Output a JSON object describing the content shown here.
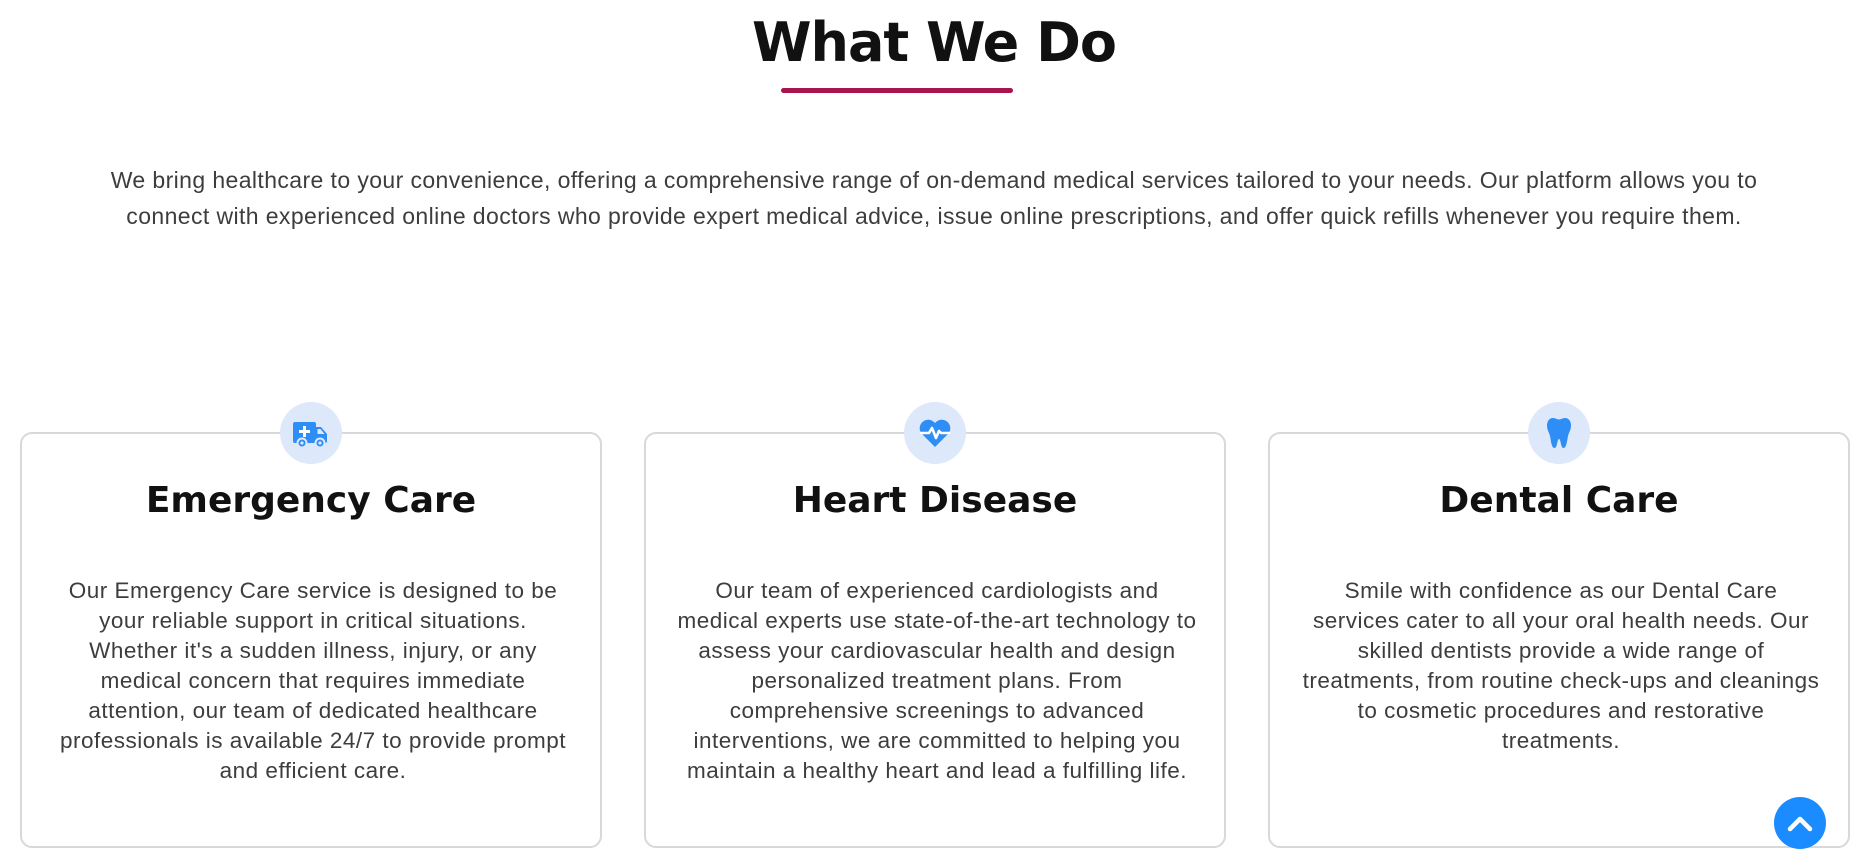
{
  "section": {
    "title": "What We Do",
    "intro": "We bring healthcare to your convenience, offering a comprehensive range of on-demand medical services tailored to your needs. Our platform allows you to connect with experienced online doctors who provide expert medical advice, issue online prescriptions, and offer quick refills whenever you require them."
  },
  "services": [
    {
      "icon": "ambulance-icon",
      "title": "Emergency Care",
      "text": "Our Emergency Care service is designed to be your reliable support in critical situations. Whether it's a sudden illness, injury, or any medical concern that requires immediate attention, our team of dedicated healthcare professionals is available 24/7 to provide prompt and efficient care."
    },
    {
      "icon": "heart-pulse-icon",
      "title": "Heart Disease",
      "text": "Our team of experienced cardiologists and medical experts use state-of-the-art technology to assess your cardiovascular health and design personalized treatment plans. From comprehensive screenings to advanced interventions, we are committed to helping you maintain a healthy heart and lead a fulfilling life."
    },
    {
      "icon": "tooth-icon",
      "title": "Dental Care",
      "text": "Smile with confidence as our Dental Care services cater to all your oral health needs. Our skilled dentists provide a wide range of treatments, from routine check-ups and cleanings to cosmetic procedures and restorative treatments."
    }
  ],
  "scroll_top": {
    "icon": "chevron-up-icon"
  },
  "colors": {
    "accent_underline": "#a8154e",
    "icon_blue": "#2f8ef5",
    "icon_bg": "#dde8fb",
    "scroll_button": "#1a8cff"
  }
}
